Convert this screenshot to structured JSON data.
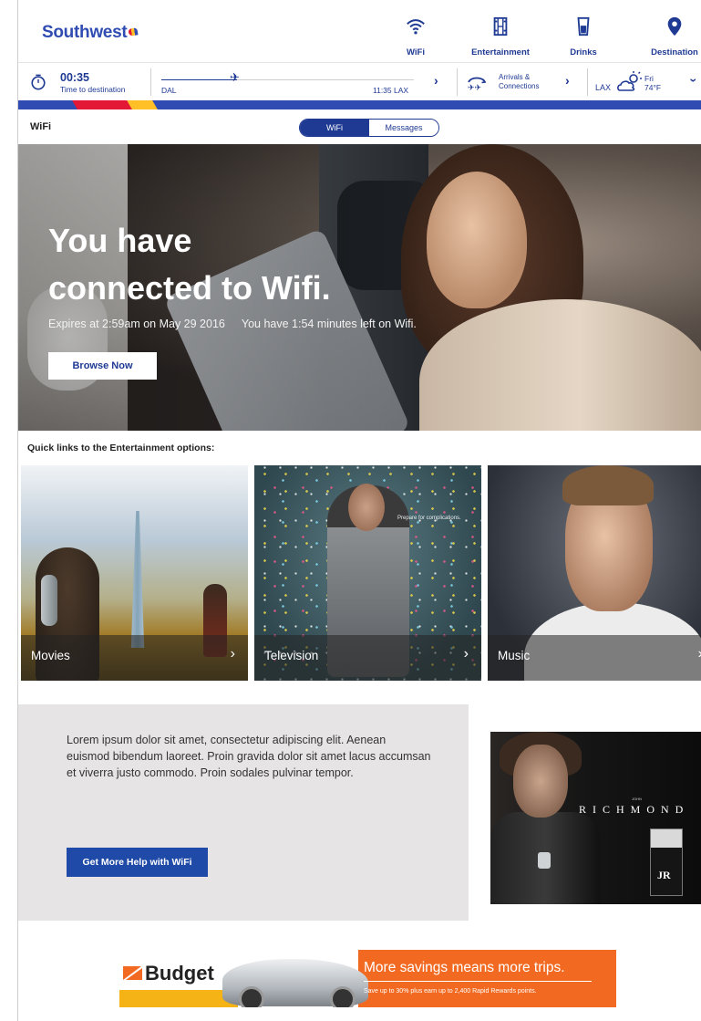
{
  "header": {
    "logo": "Southwest",
    "nav": [
      {
        "label": "WiFi",
        "icon": "wifi-icon"
      },
      {
        "label": "Entertainment",
        "icon": "film-icon"
      },
      {
        "label": "Drinks",
        "icon": "drink-icon"
      },
      {
        "label": "Destination",
        "icon": "location-pin-icon"
      }
    ]
  },
  "flight": {
    "time_remaining": "00:35",
    "time_label": "Time to destination",
    "origin": "DAL",
    "arrival": "11:35 LAX",
    "progress_fraction": 0.3,
    "connections_label_1": "Arrivals &",
    "connections_label_2": "Connections",
    "destination": "LAX",
    "weather_day": "Fri",
    "weather_temp": "74°F"
  },
  "section": {
    "title": "WiFi",
    "tabs": [
      "WiFi",
      "Messages"
    ],
    "active_tab": "WiFi"
  },
  "hero": {
    "heading_line1": "You have",
    "heading_line2": "connected to Wifi.",
    "expires": "Expires at 2:59am on May 29 2016",
    "remaining": "You have 1:54 minutes left on Wifi.",
    "button": "Browse Now"
  },
  "quick_links": {
    "title": "Quick links to the Entertainment options:",
    "items": [
      {
        "label": "Movies"
      },
      {
        "label": "Television",
        "tagline": "Prepare for complications."
      },
      {
        "label": "Music"
      }
    ]
  },
  "help": {
    "body": "Lorem ipsum dolor sit amet, consectetur adipiscing elit. Aenean euismod bibendum laoreet. Proin gravida dolor sit amet lacus accumsan et viverra justo commodo. Proin sodales pulvinar tempor.",
    "button": "Get More Help with WiFi"
  },
  "ad": {
    "john": "JOHN",
    "brand": "RICHMOND",
    "monogram": "JR"
  },
  "banner": {
    "brand": "Budget",
    "headline": "More savings means more trips.",
    "fine_print": "Save up to 30% plus earn up to 2,400 Rapid Rewards points."
  },
  "colors": {
    "brand_blue": "#304cb2",
    "brand_red": "#e31837",
    "brand_yellow": "#ffbf27",
    "button_blue": "#1f4aa8",
    "budget_orange": "#f26a21"
  }
}
